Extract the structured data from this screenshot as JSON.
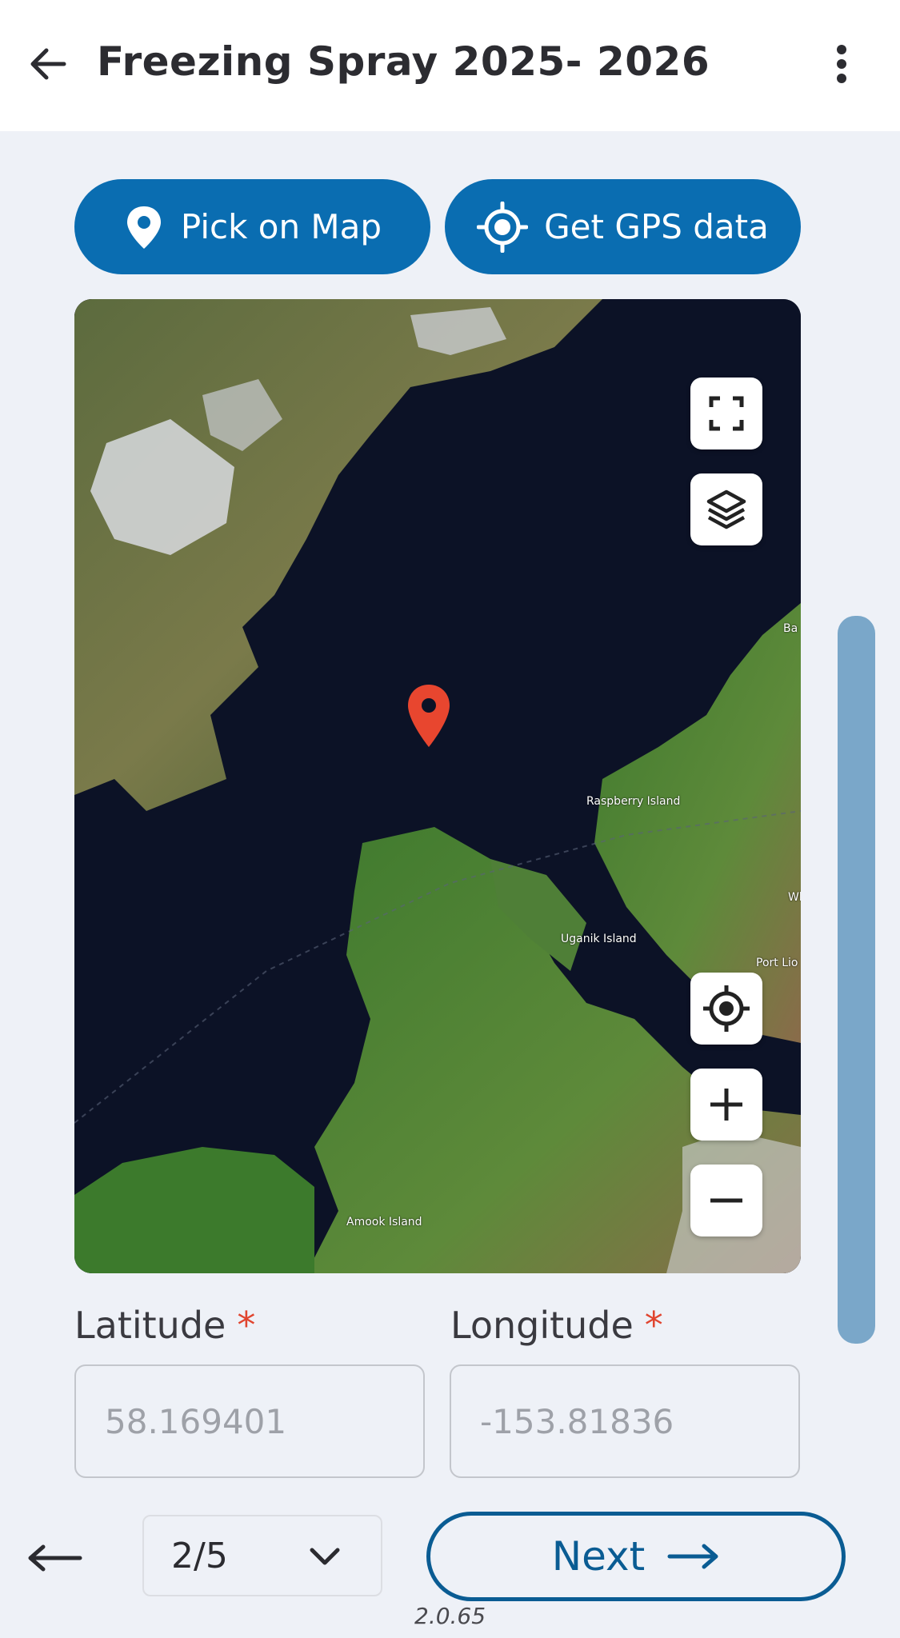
{
  "header": {
    "title": "Freezing Spray 2025- 2026",
    "back_icon": "arrow-left-icon",
    "menu_icon": "more-vert-icon"
  },
  "actions": {
    "pick_on_map_label": "Pick on Map",
    "pick_on_map_icon": "map-pin-icon",
    "get_gps_label": "Get GPS data",
    "get_gps_icon": "gps-target-icon"
  },
  "map": {
    "place_labels": {
      "raspberry_island": "Raspberry Island",
      "uganik_island": "Uganik Island",
      "amook_island": "Amook Island",
      "port_lions": "Port Lio",
      "edge_top": "Ba",
      "edge_mid": "Wh"
    },
    "controls": [
      "fullscreen-icon",
      "layers-icon",
      "my-location-icon",
      "zoom-in-icon",
      "zoom-out-icon"
    ],
    "marker_color": "#e8462f"
  },
  "form": {
    "latitude_label": "Latitude",
    "longitude_label": "Longitude",
    "required_mark": "*",
    "latitude_value": "58.169401",
    "longitude_value": "-153.81836"
  },
  "footer": {
    "page_indicator": "2/5",
    "next_label": "Next",
    "version": "2.0.65"
  },
  "colors": {
    "primary": "#0a6db1",
    "next_border": "#0a5c93",
    "required": "#e0452f",
    "scrollbar": "#7aa7c9",
    "background": "#eef1f7"
  }
}
